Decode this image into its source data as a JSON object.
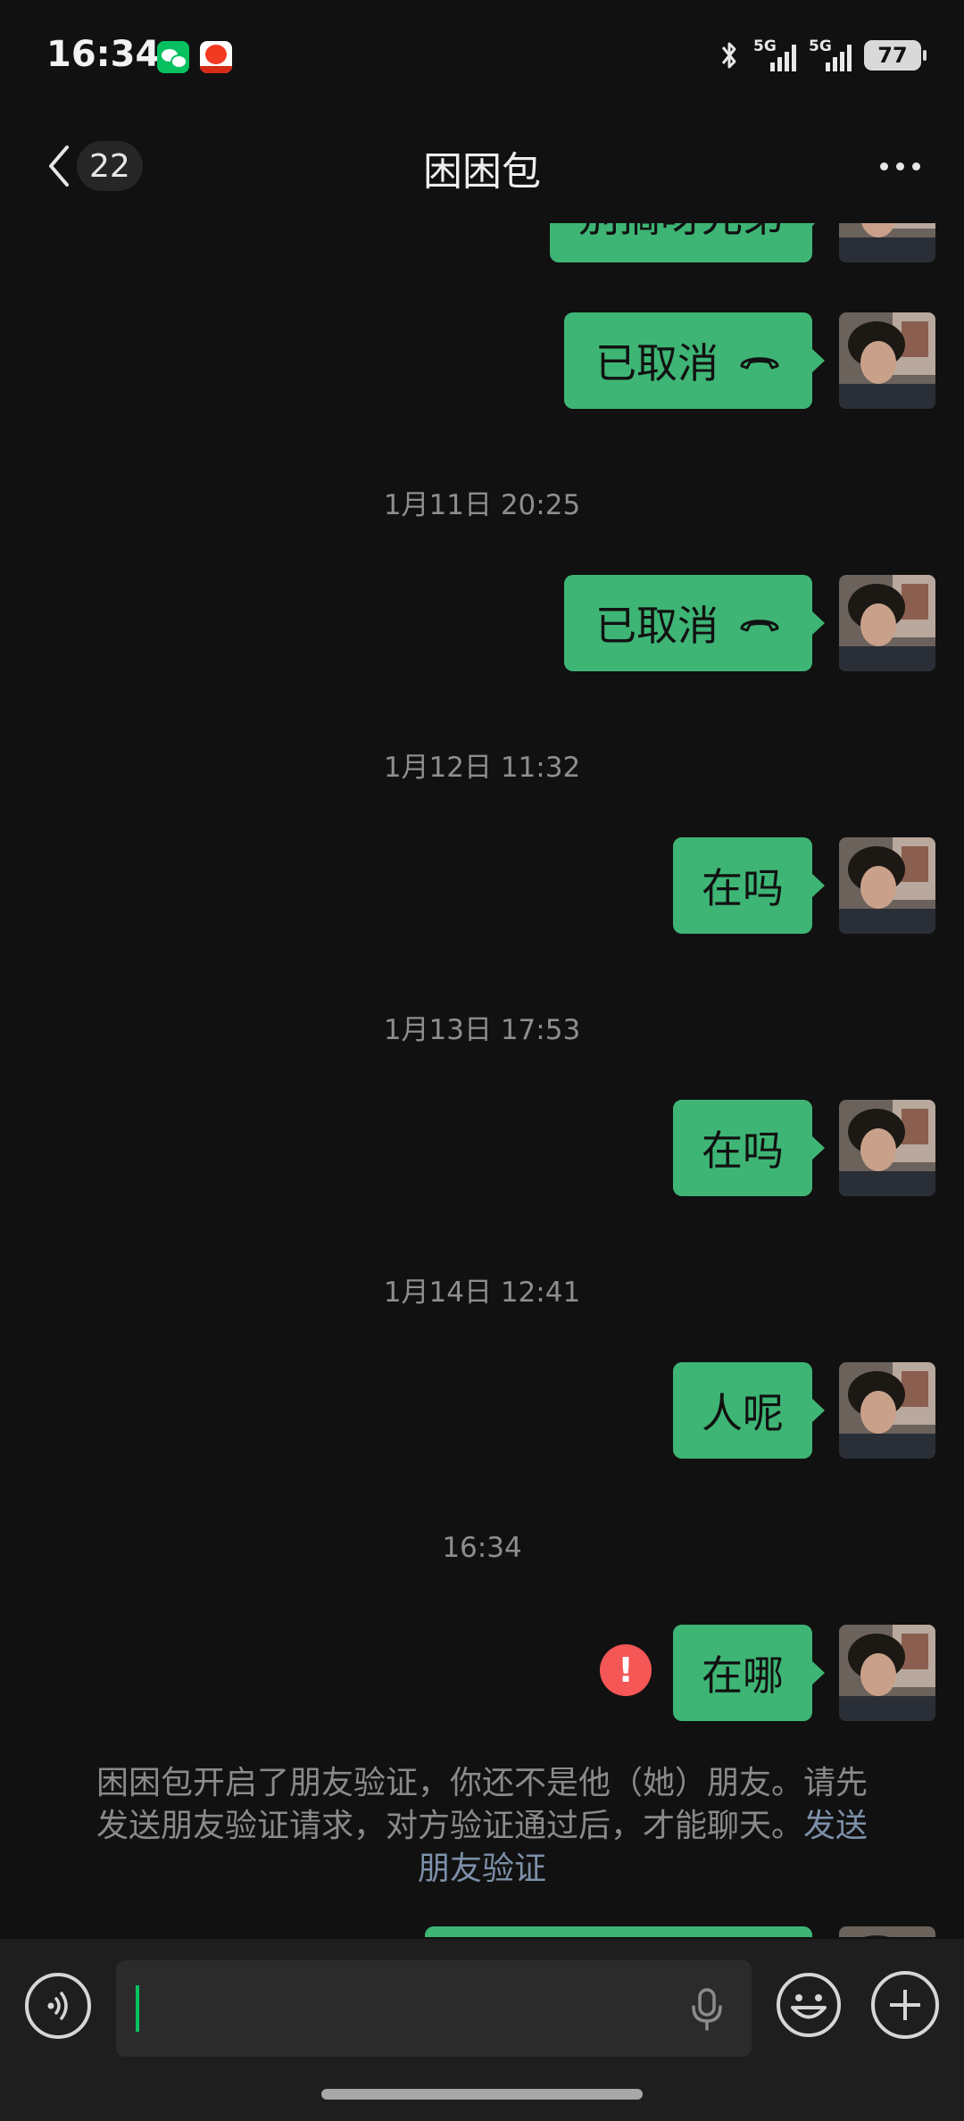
{
  "status_bar": {
    "time": "16:34",
    "network_1": "5G",
    "network_2": "5G",
    "battery": "77",
    "icons": [
      "wechat-app-icon",
      "shop-app-icon",
      "bluetooth-icon",
      "signal-icon",
      "battery-icon"
    ]
  },
  "header": {
    "unread_count": "22",
    "title": "困困包",
    "icons": [
      "back-arrow-icon",
      "more-dots-icon"
    ]
  },
  "messages": [
    {
      "type": "text",
      "text": "别搞呀兄弟",
      "partial": true
    },
    {
      "type": "call",
      "text": "已取消",
      "icon": "hangup-phone-icon"
    },
    {
      "type": "time",
      "text": "1月11日 20:25"
    },
    {
      "type": "call",
      "text": "已取消",
      "icon": "hangup-phone-icon"
    },
    {
      "type": "time",
      "text": "1月12日 11:32"
    },
    {
      "type": "text",
      "text": "在吗"
    },
    {
      "type": "time",
      "text": "1月13日 17:53"
    },
    {
      "type": "text",
      "text": "在吗"
    },
    {
      "type": "time",
      "text": "1月14日 12:41"
    },
    {
      "type": "text",
      "text": "人呢"
    },
    {
      "type": "time",
      "text": "16:34"
    },
    {
      "type": "text",
      "text": "在哪",
      "failed": true,
      "error_mark": "!"
    }
  ],
  "system_notice": {
    "line_1": "困困包开启了朋友验证，你还不是他（她）朋友。请先",
    "line_2": "发送朋友验证请求，对方验证通过后，才能聊天。",
    "link_part_1": "发送",
    "link_part_2": "朋友验证"
  },
  "input_bar": {
    "value": "",
    "icons": [
      "voice-icon",
      "microphone-icon",
      "emoji-icon",
      "plus-icon"
    ]
  },
  "colors": {
    "background": "#111111",
    "bubble": "#3eb575",
    "accent": "#07c160",
    "error": "#f55656",
    "link": "#7d90a9"
  }
}
